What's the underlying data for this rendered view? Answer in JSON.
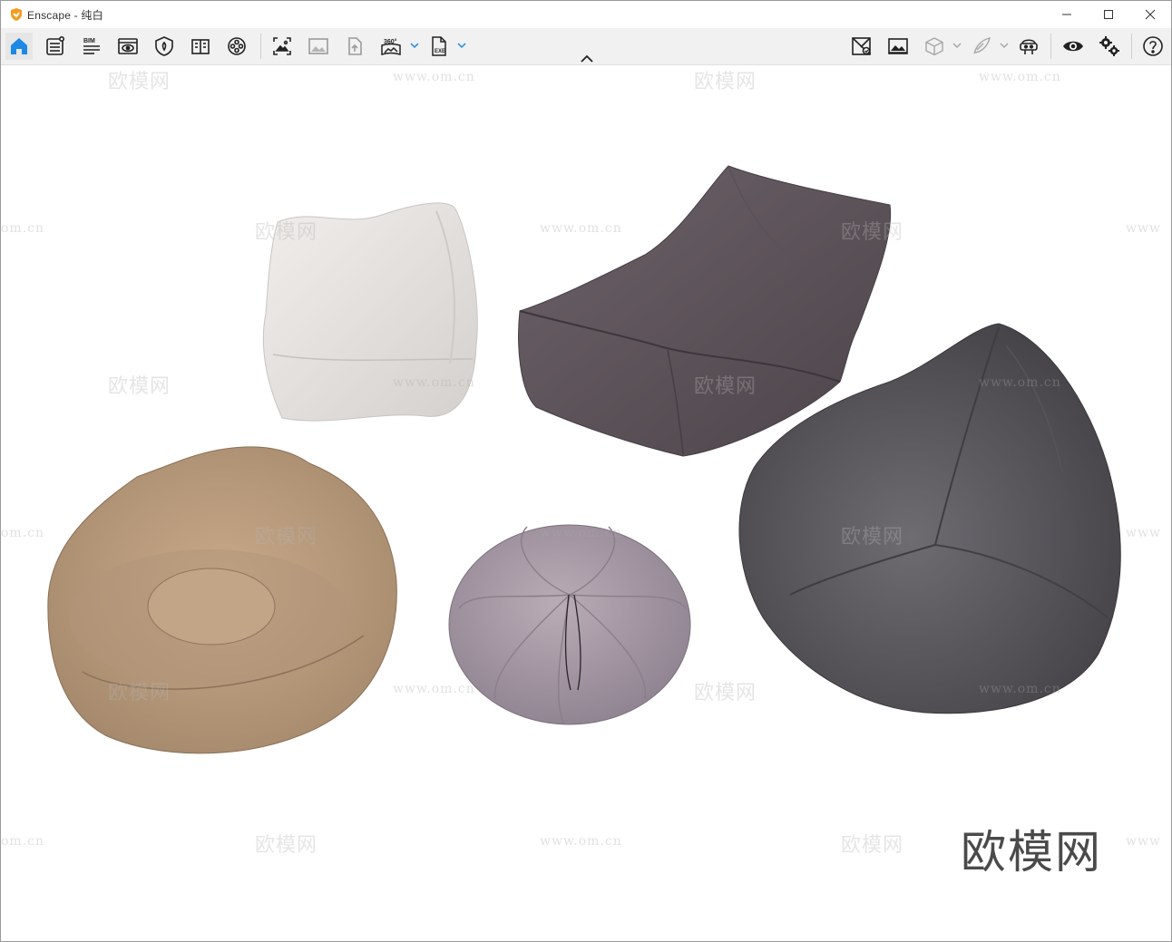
{
  "window": {
    "title": "Enscape - 纯白",
    "controls": [
      "minimize-icon",
      "maximize-icon",
      "close-icon"
    ]
  },
  "toolbar": {
    "left_icons": [
      "home-icon",
      "settings-list-icon",
      "bim-icon",
      "view-icon",
      "safe-frame-icon",
      "book-icon",
      "video-reel-icon",
      "screenshot-icon",
      "image-icon",
      "upload-icon",
      "panorama-360-icon",
      "export-exe-icon"
    ],
    "bim_label": "BIM",
    "pano_label": "360°",
    "exe_label": "EXE",
    "right_icons": [
      "asset-library-icon",
      "render-gallery-icon",
      "box-icon",
      "feather-icon",
      "vr-headset-icon",
      "eye-icon",
      "gear-icon",
      "help-icon"
    ],
    "accent_color": "#1e88e5"
  },
  "viewport": {
    "watermark_brand": "欧模网",
    "watermark_url": "www.om.cn",
    "watermark_url_partial": "om.cn",
    "watermark_url_partial_right": "www",
    "objects": [
      "white-cube-bean-bag",
      "purple-gray-lounge-bean-chair",
      "beige-round-bean-bag",
      "lilac-pumpkin-pouf",
      "dark-gray-teardrop-bean-bag"
    ]
  }
}
